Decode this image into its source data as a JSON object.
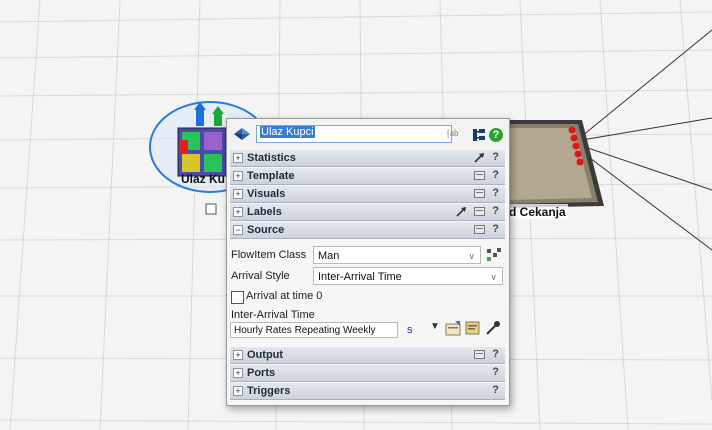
{
  "scene": {
    "source_object_label": "Ulaz Ku",
    "queue_object_label": "d Cekanja"
  },
  "panel": {
    "object_name": "Ulaz Kupci",
    "label_icon_text": "[ab",
    "help_glyph": "?",
    "sections_top": [
      {
        "label": "Statistics",
        "toggle": "+",
        "icons": [
          "arrow-icon"
        ]
      },
      {
        "label": "Template",
        "toggle": "+",
        "icons": [
          "pin-icon"
        ]
      },
      {
        "label": "Visuals",
        "toggle": "+",
        "icons": [
          "pin-icon"
        ]
      },
      {
        "label": "Labels",
        "toggle": "+",
        "icons": [
          "arrow-icon",
          "pin-icon"
        ]
      },
      {
        "label": "Source",
        "toggle": "−",
        "icons": [
          "pin-icon"
        ]
      }
    ],
    "source": {
      "flowitem_class_label": "FlowItem Class",
      "flowitem_class_value": "Man",
      "arrival_style_label": "Arrival Style",
      "arrival_style_value": "Inter-Arrival Time",
      "arrival_at_time0_label": "Arrival at time 0",
      "arrival_at_time0_checked": false,
      "inter_arrival_label": "Inter-Arrival Time",
      "inter_arrival_value": "Hourly Rates Repeating Weekly",
      "unit": "s"
    },
    "sections_bottom": [
      {
        "label": "Output",
        "toggle": "+",
        "icons": [
          "pin-icon"
        ]
      },
      {
        "label": "Ports",
        "toggle": "+",
        "icons": []
      },
      {
        "label": "Triggers",
        "toggle": "+",
        "icons": []
      }
    ],
    "colors": {
      "section_header": "#d6dbe3",
      "selection": "#3a7bd5",
      "help": "#2fa32f"
    }
  }
}
